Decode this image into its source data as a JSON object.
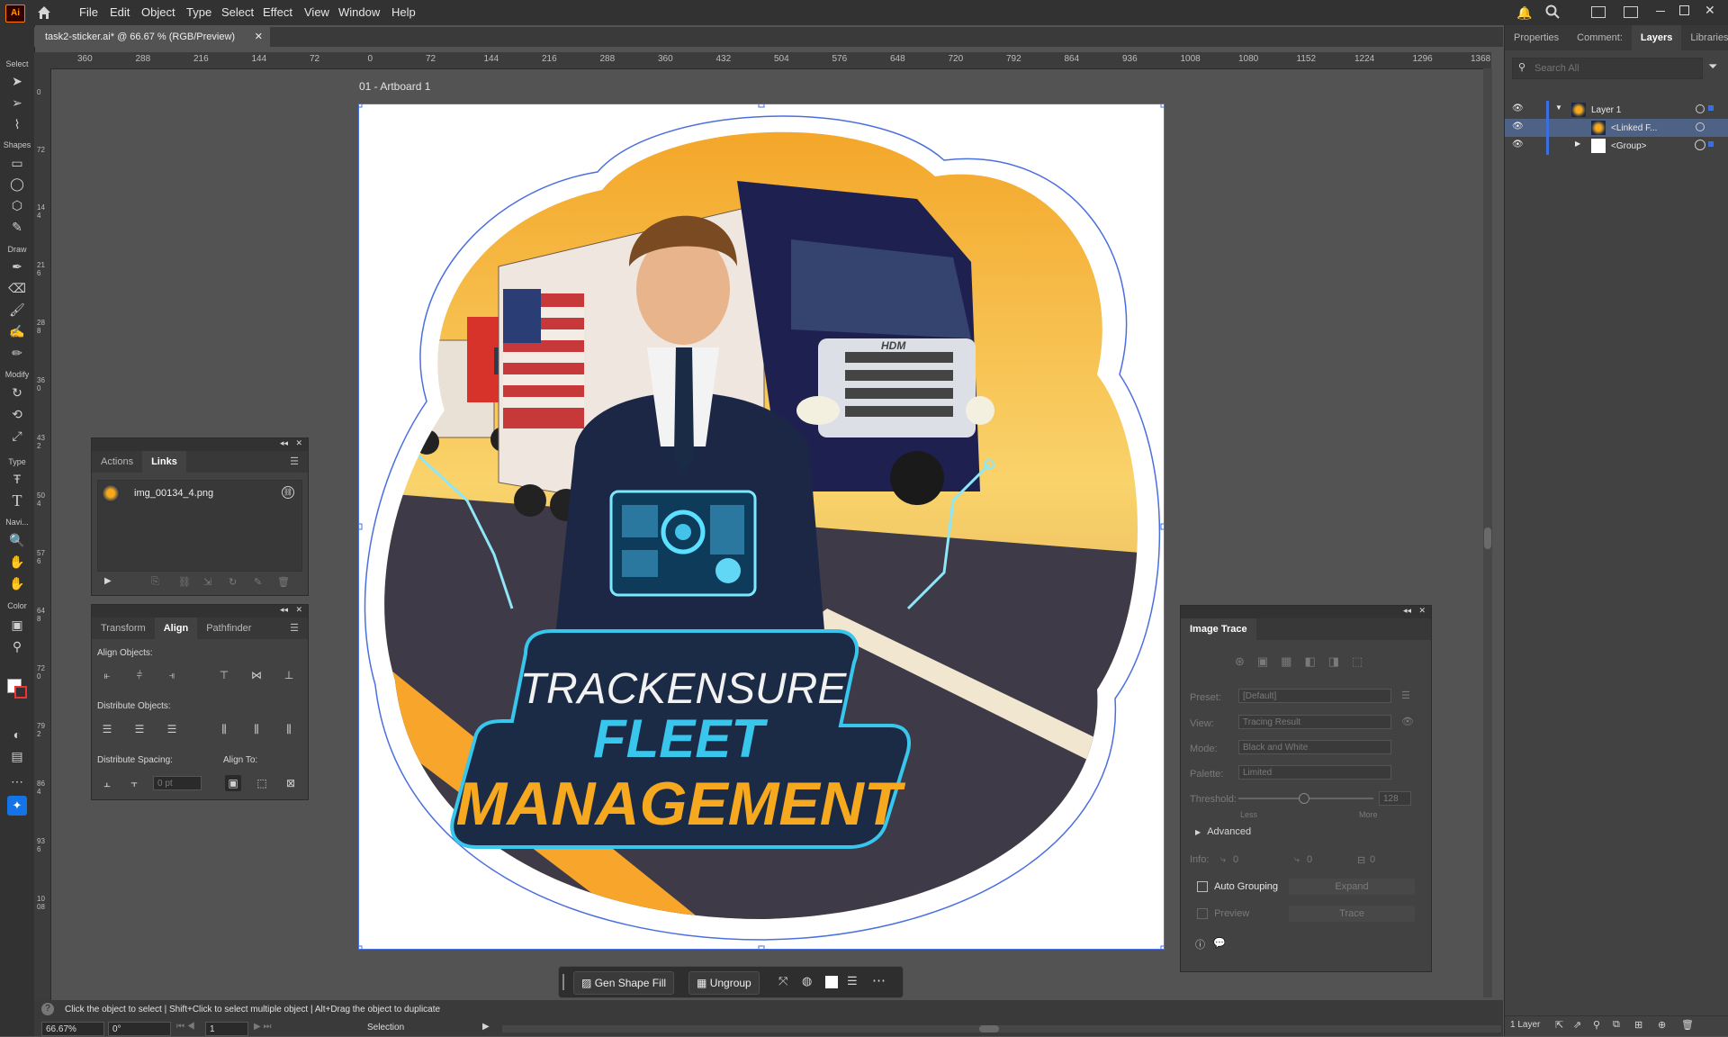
{
  "menubar": {
    "logo": "Ai",
    "items": [
      "File",
      "Edit",
      "Object",
      "Type",
      "Select",
      "Effect",
      "View",
      "Window",
      "Help"
    ]
  },
  "document": {
    "tab_title": "task2-sticker.ai* @ 66.67 % (RGB/Preview)",
    "artboard_label": "01 - Artboard 1"
  },
  "ruler": {
    "h_ticks": [
      "360",
      "288",
      "216",
      "144",
      "72",
      "0",
      "72",
      "144",
      "216",
      "288",
      "360",
      "432",
      "504",
      "576",
      "648",
      "720",
      "792",
      "864",
      "936",
      "1008",
      "1080",
      "1152",
      "1224",
      "1296",
      "1368"
    ],
    "v_ticks": [
      "0",
      "7 2",
      "1 4 4",
      "2 1 6",
      "2 8 8",
      "3 6 0",
      "4 3 2",
      "5 0 4",
      "5 7 6",
      "6 4 8",
      "7 2 0",
      "7 9 2",
      "8 6 4",
      "9 3 6",
      "1 0 0 8"
    ]
  },
  "toolbar": {
    "labels": [
      "Select",
      "Shapes",
      "Draw",
      "Modify",
      "Type",
      "Navi...",
      "Color"
    ]
  },
  "artwork": {
    "line1": "TRACKENSURE",
    "line2": "FLEET",
    "line3": "MANAGEMENT",
    "truck_brand": "HDM",
    "colors": {
      "navy": "#1c2b45",
      "orange": "#f6a91e",
      "cyan": "#39c6ec",
      "cab": "#1e2150"
    }
  },
  "links_panel": {
    "tabs": [
      "Actions",
      "Links"
    ],
    "active_tab": "Links",
    "items": [
      {
        "name": "img_00134_4.png"
      }
    ]
  },
  "align_panel": {
    "tabs": [
      "Transform",
      "Align",
      "Pathfinder"
    ],
    "active_tab": "Align",
    "align_objects": "Align Objects:",
    "distribute_objects": "Distribute Objects:",
    "distribute_spacing": "Distribute Spacing:",
    "align_to": "Align To:",
    "spacing_value": "0 pt"
  },
  "image_trace": {
    "title": "Image Trace",
    "preset_label": "Preset:",
    "preset_value": "[Default]",
    "view_label": "View:",
    "view_value": "Tracing Result",
    "mode_label": "Mode:",
    "mode_value": "Black and White",
    "palette_label": "Palette:",
    "palette_value": "Limited",
    "threshold_label": "Threshold:",
    "threshold_value": "128",
    "less": "Less",
    "more": "More",
    "advanced": "Advanced",
    "info_label": "Info:",
    "info_paths": "0",
    "info_anchors": "0",
    "info_colors": "0",
    "auto_grouping": "Auto Grouping",
    "expand": "Expand",
    "preview": "Preview",
    "trace": "Trace"
  },
  "context_bar": {
    "gen_shape_fill": "Gen Shape Fill",
    "ungroup": "Ungroup"
  },
  "right_panel": {
    "tabs": [
      "Properties",
      "Comment:",
      "Layers",
      "Libraries"
    ],
    "active_tab": "Layers",
    "search_placeholder": "Search All",
    "layers": [
      {
        "name": "Layer 1"
      },
      {
        "name": "<Linked F..."
      },
      {
        "name": "<Group>"
      }
    ],
    "footer_count": "1 Layer"
  },
  "status": {
    "hint": "Click the object to select  |  Shift+Click to select multiple object  |  Alt+Drag the object to duplicate",
    "zoom": "66.67%",
    "rotation": "0°",
    "artboard_num": "1",
    "tool": "Selection"
  }
}
